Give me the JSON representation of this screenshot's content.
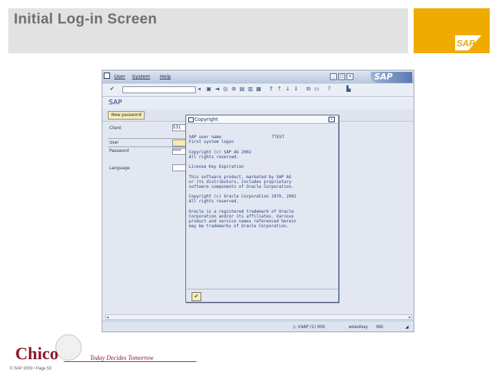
{
  "slide": {
    "title": "Initial Log-in Screen",
    "footer": "© SAP 2009 / Page 53",
    "tagline": "Today Decides Tomorrow",
    "school": "Chico"
  },
  "sap_gui": {
    "menu": [
      "User",
      "System",
      "Help"
    ],
    "app_title": "SAP",
    "new_password_button": "New password",
    "fields": [
      {
        "label": "Client",
        "value": "531"
      },
      {
        "label": "User",
        "value": ""
      },
      {
        "label": "Password",
        "value": "****"
      },
      {
        "label": "Language",
        "value": ""
      }
    ],
    "status": {
      "system": "▷ V4AP (1) 000",
      "server": "wsss4ssy",
      "mode": "INS"
    }
  },
  "dialog": {
    "title": "Copyright",
    "user_label": "SAP user name",
    "user_value": "TTEST",
    "lines": [
      "First system logon",
      "",
      "Copyright (c) SAP AG 2002",
      "All rights reserved.",
      "",
      "License Key Expiration",
      "",
      "This software product, marketed by SAP AG",
      "or its distributors, includes proprietary",
      "software components of Oracle Corporation.",
      "",
      "Copyright (c) Oracle Corporation 1979, 2002",
      "All rights reserved.",
      "",
      "Oracle is a registered trademark of Oracle",
      "Corporation and/or its affiliates. Various",
      "product and service names referenced herein",
      "may be trademarks of Oracle Corporation."
    ]
  },
  "colors": {
    "logo_bg": "#f0ab00",
    "header_bg": "#e2e2e2",
    "gui_bg": "#e3e7f1",
    "accent_blue": "#1d3f7a",
    "chico_red": "#8a1c2b"
  }
}
